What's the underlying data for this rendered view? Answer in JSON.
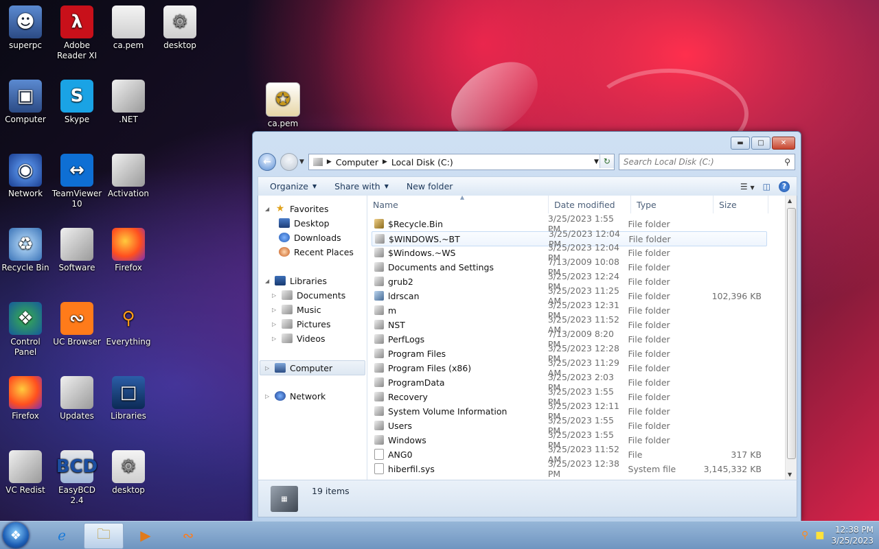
{
  "desktop": {
    "icons": [
      {
        "label": "superpc",
        "glyph": "user-icon"
      },
      {
        "label": "Adobe Reader XI",
        "glyph": "pdf-icon"
      },
      {
        "label": "ca.pem",
        "glyph": "file-icon"
      },
      {
        "label": "desktop",
        "glyph": "settings-file-icon"
      },
      {
        "label": "Computer",
        "glyph": "computer-icon"
      },
      {
        "label": "Skype",
        "glyph": "skype-icon"
      },
      {
        "label": ".NET",
        "glyph": "folder-icon"
      },
      {
        "label": "ca.pem",
        "glyph": "certificate-icon"
      },
      {
        "label": "Network",
        "glyph": "network-icon"
      },
      {
        "label": "TeamViewer 10",
        "glyph": "teamviewer-icon"
      },
      {
        "label": "Activation",
        "glyph": "folder-icon"
      },
      {
        "label": "Recycle Bin",
        "glyph": "recycle-bin-icon"
      },
      {
        "label": "Software",
        "glyph": "folder-icon"
      },
      {
        "label": "Firefox",
        "glyph": "firefox-icon"
      },
      {
        "label": "Control Panel",
        "glyph": "control-panel-icon"
      },
      {
        "label": "UC Browser",
        "glyph": "uc-browser-icon"
      },
      {
        "label": "Everything",
        "glyph": "search-icon"
      },
      {
        "label": "Firefox",
        "glyph": "firefox-icon"
      },
      {
        "label": "Updates",
        "glyph": "folder-icon"
      },
      {
        "label": "Libraries",
        "glyph": "libraries-icon"
      },
      {
        "label": "VC Redist",
        "glyph": "folder-icon"
      },
      {
        "label": "EasyBCD 2.4",
        "glyph": "easybcd-icon"
      },
      {
        "label": "desktop",
        "glyph": "settings-file-icon"
      }
    ]
  },
  "explorer": {
    "address": {
      "segments": [
        "Computer",
        "Local Disk (C:)"
      ]
    },
    "search_placeholder": "Search Local Disk (C:)",
    "toolbar": {
      "organize": "Organize",
      "share_with": "Share with",
      "new_folder": "New folder"
    },
    "nav": {
      "favorites": "Favorites",
      "favorites_items": [
        "Desktop",
        "Downloads",
        "Recent Places"
      ],
      "libraries": "Libraries",
      "libraries_items": [
        "Documents",
        "Music",
        "Pictures",
        "Videos"
      ],
      "computer": "Computer",
      "network": "Network"
    },
    "columns": {
      "name": "Name",
      "date": "Date modified",
      "type": "Type",
      "size": "Size"
    },
    "rows": [
      {
        "name": "$Recycle.Bin",
        "date": "3/25/2023 1:55 PM",
        "type": "File folder",
        "size": ""
      },
      {
        "name": "$WINDOWS.~BT",
        "date": "3/25/2023 12:04 PM",
        "type": "File folder",
        "size": ""
      },
      {
        "name": "$Windows.~WS",
        "date": "3/25/2023 12:04 PM",
        "type": "File folder",
        "size": ""
      },
      {
        "name": "Documents and Settings",
        "date": "7/13/2009 10:08 PM",
        "type": "File folder",
        "size": ""
      },
      {
        "name": "grub2",
        "date": "3/25/2023 12:24 PM",
        "type": "File folder",
        "size": ""
      },
      {
        "name": "ldrscan",
        "date": "3/25/2023 11:25 AM",
        "type": "File folder",
        "size": "102,396 KB"
      },
      {
        "name": "m",
        "date": "3/25/2023 12:31 PM",
        "type": "File folder",
        "size": ""
      },
      {
        "name": "NST",
        "date": "3/25/2023 11:52 AM",
        "type": "File folder",
        "size": ""
      },
      {
        "name": "PerfLogs",
        "date": "7/13/2009 8:20 PM",
        "type": "File folder",
        "size": ""
      },
      {
        "name": "Program Files",
        "date": "3/25/2023 12:28 PM",
        "type": "File folder",
        "size": ""
      },
      {
        "name": "Program Files (x86)",
        "date": "3/25/2023 11:29 AM",
        "type": "File folder",
        "size": ""
      },
      {
        "name": "ProgramData",
        "date": "3/25/2023 2:03 PM",
        "type": "File folder",
        "size": ""
      },
      {
        "name": "Recovery",
        "date": "3/25/2023 1:55 PM",
        "type": "File folder",
        "size": ""
      },
      {
        "name": "System Volume Information",
        "date": "3/25/2023 12:11 PM",
        "type": "File folder",
        "size": ""
      },
      {
        "name": "Users",
        "date": "3/25/2023 1:55 PM",
        "type": "File folder",
        "size": ""
      },
      {
        "name": "Windows",
        "date": "3/25/2023 1:55 PM",
        "type": "File folder",
        "size": ""
      },
      {
        "name": "ANG0",
        "date": "3/25/2023 11:52 AM",
        "type": "File",
        "size": "317 KB"
      },
      {
        "name": "hiberfil.sys",
        "date": "3/25/2023 12:38 PM",
        "type": "System file",
        "size": "3,145,332 KB"
      }
    ],
    "details": {
      "count": "19 items"
    }
  },
  "taskbar": {
    "time": "12:38 PM",
    "date": "3/25/2023"
  }
}
